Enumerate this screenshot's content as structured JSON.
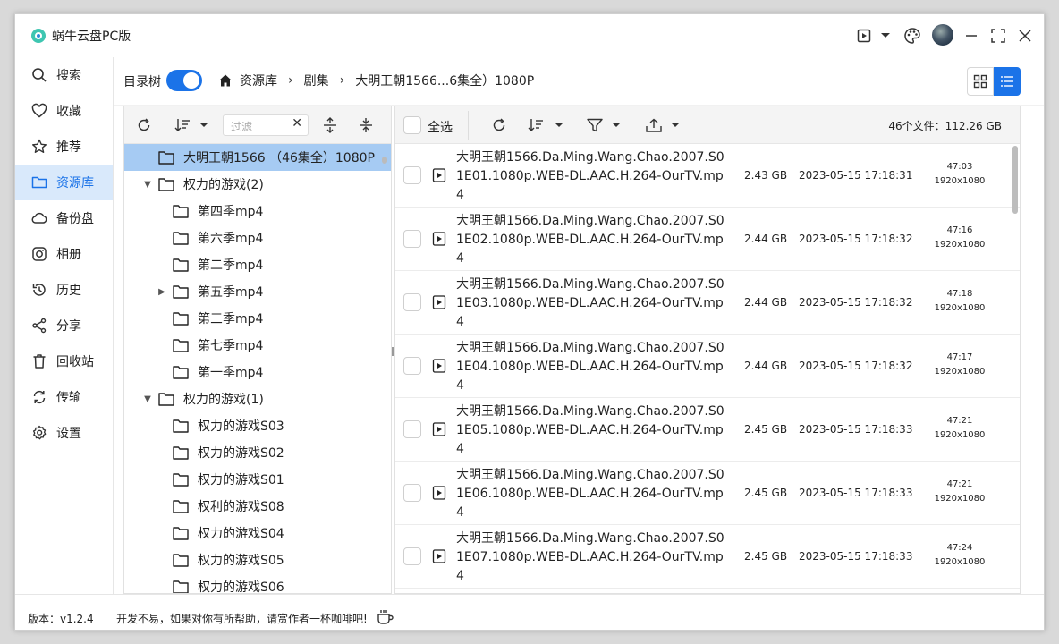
{
  "app": {
    "title": "蜗牛云盘PC版"
  },
  "colors": {
    "accent": "#1b73e8",
    "selected_row": "#a6cbf3",
    "sidebar_active_bg": "#d9e9fb"
  },
  "sidebar": {
    "items": [
      {
        "label": "搜索",
        "icon": "search-icon"
      },
      {
        "label": "收藏",
        "icon": "heart-icon"
      },
      {
        "label": "推荐",
        "icon": "star-icon"
      },
      {
        "label": "资源库",
        "icon": "folder-icon",
        "active": true
      },
      {
        "label": "备份盘",
        "icon": "cloud-icon"
      },
      {
        "label": "相册",
        "icon": "album-icon"
      },
      {
        "label": "历史",
        "icon": "history-icon"
      },
      {
        "label": "分享",
        "icon": "share-icon"
      },
      {
        "label": "回收站",
        "icon": "trash-icon"
      },
      {
        "label": "传输",
        "icon": "transfer-icon"
      },
      {
        "label": "设置",
        "icon": "gear-icon"
      }
    ]
  },
  "toolbar": {
    "tree_label": "目录树",
    "tree_toggle_on": true,
    "breadcrumb": [
      "资源库",
      "剧集",
      "大明王朝1566...6集全）1080P"
    ]
  },
  "tree": {
    "filter_placeholder": "过滤",
    "rows": [
      {
        "label": "大明王朝1566 （46集全）1080P",
        "level": 0,
        "caret": "",
        "selected": true
      },
      {
        "label": "权力的游戏(2)",
        "level": 0,
        "caret": "▼"
      },
      {
        "label": "第四季mp4",
        "level": 1,
        "caret": ""
      },
      {
        "label": "第六季mp4",
        "level": 1,
        "caret": ""
      },
      {
        "label": "第二季mp4",
        "level": 1,
        "caret": ""
      },
      {
        "label": "第五季mp4",
        "level": 1,
        "caret": "▶"
      },
      {
        "label": "第三季mp4",
        "level": 1,
        "caret": ""
      },
      {
        "label": "第七季mp4",
        "level": 1,
        "caret": ""
      },
      {
        "label": "第一季mp4",
        "level": 1,
        "caret": ""
      },
      {
        "label": "权力的游戏(1)",
        "level": 0,
        "caret": "▼"
      },
      {
        "label": "权力的游戏S03",
        "level": 1,
        "caret": ""
      },
      {
        "label": "权力的游戏S02",
        "level": 1,
        "caret": ""
      },
      {
        "label": "权力的游戏S01",
        "level": 1,
        "caret": ""
      },
      {
        "label": "权利的游戏S08",
        "level": 1,
        "caret": ""
      },
      {
        "label": "权力的游戏S04",
        "level": 1,
        "caret": ""
      },
      {
        "label": "权力的游戏S05",
        "level": 1,
        "caret": ""
      },
      {
        "label": "权力的游戏S06",
        "level": 1,
        "caret": ""
      }
    ]
  },
  "files": {
    "select_all": "全选",
    "count_text": "46个文件：112.26 GB",
    "rows": [
      {
        "name": "大明王朝1566.Da.Ming.Wang.Chao.2007.S01E01.1080p.WEB-DL.AAC.H.264-OurTV.mp4",
        "size": "2.43 GB",
        "date": "2023-05-15 17:18:31",
        "duration": "47:03",
        "resolution": "1920x1080"
      },
      {
        "name": "大明王朝1566.Da.Ming.Wang.Chao.2007.S01E02.1080p.WEB-DL.AAC.H.264-OurTV.mp4",
        "size": "2.44 GB",
        "date": "2023-05-15 17:18:32",
        "duration": "47:16",
        "resolution": "1920x1080"
      },
      {
        "name": "大明王朝1566.Da.Ming.Wang.Chao.2007.S01E03.1080p.WEB-DL.AAC.H.264-OurTV.mp4",
        "size": "2.44 GB",
        "date": "2023-05-15 17:18:32",
        "duration": "47:18",
        "resolution": "1920x1080"
      },
      {
        "name": "大明王朝1566.Da.Ming.Wang.Chao.2007.S01E04.1080p.WEB-DL.AAC.H.264-OurTV.mp4",
        "size": "2.44 GB",
        "date": "2023-05-15 17:18:32",
        "duration": "47:17",
        "resolution": "1920x1080"
      },
      {
        "name": "大明王朝1566.Da.Ming.Wang.Chao.2007.S01E05.1080p.WEB-DL.AAC.H.264-OurTV.mp4",
        "size": "2.45 GB",
        "date": "2023-05-15 17:18:33",
        "duration": "47:21",
        "resolution": "1920x1080"
      },
      {
        "name": "大明王朝1566.Da.Ming.Wang.Chao.2007.S01E06.1080p.WEB-DL.AAC.H.264-OurTV.mp4",
        "size": "2.45 GB",
        "date": "2023-05-15 17:18:33",
        "duration": "47:21",
        "resolution": "1920x1080"
      },
      {
        "name": "大明王朝1566.Da.Ming.Wang.Chao.2007.S01E07.1080p.WEB-DL.AAC.H.264-OurTV.mp4",
        "size": "2.45 GB",
        "date": "2023-05-15 17:18:33",
        "duration": "47:24",
        "resolution": "1920x1080"
      }
    ]
  },
  "status": {
    "version": "版本：v1.2.4",
    "message": "开发不易，如果对你有所帮助，请赏作者一杯咖啡吧!"
  }
}
